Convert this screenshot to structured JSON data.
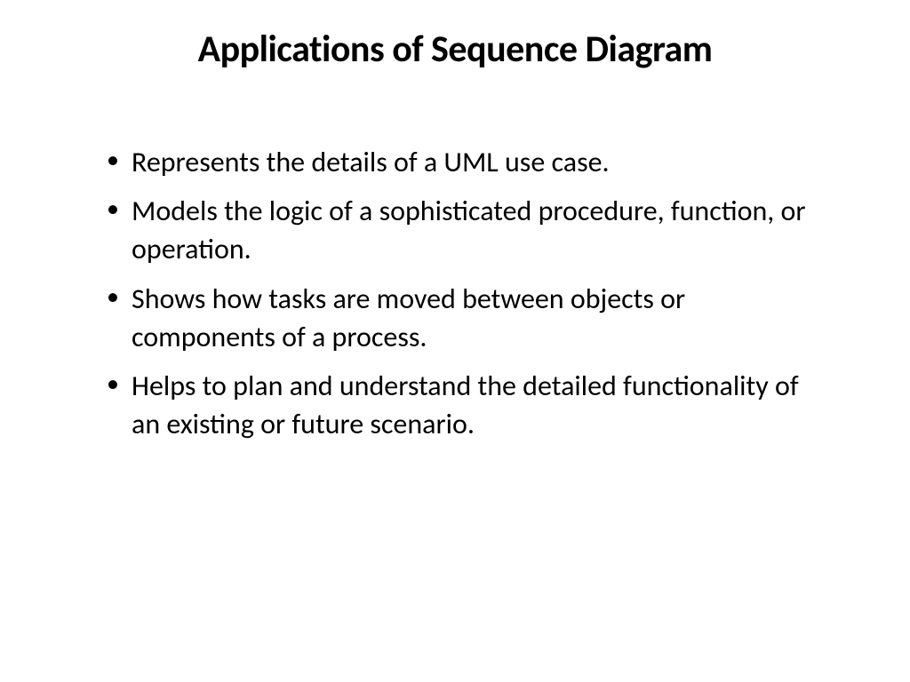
{
  "slide": {
    "title": "Applications of Sequence Diagram",
    "bullets": [
      "Represents the details of a UML use case.",
      "Models the logic of a sophisticated procedure, function, or operation.",
      "Shows how tasks are moved between objects or components of a process.",
      "Helps to plan and understand the detailed functionality of an existing or future scenario."
    ]
  }
}
